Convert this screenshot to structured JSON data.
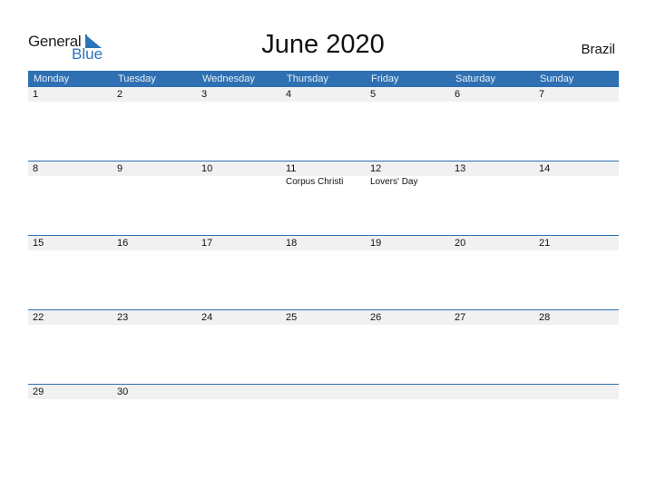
{
  "logo": {
    "word1": "General",
    "word2": "Blue"
  },
  "title": "June 2020",
  "country": "Brazil",
  "colors": {
    "header": "#2e70b1",
    "row_bg": "#f1f1f1"
  },
  "weekdays": [
    "Monday",
    "Tuesday",
    "Wednesday",
    "Thursday",
    "Friday",
    "Saturday",
    "Sunday"
  ],
  "weeks": [
    {
      "days": [
        "1",
        "2",
        "3",
        "4",
        "5",
        "6",
        "7"
      ],
      "holidays": [
        "",
        "",
        "",
        "",
        "",
        "",
        ""
      ]
    },
    {
      "days": [
        "8",
        "9",
        "10",
        "11",
        "12",
        "13",
        "14"
      ],
      "holidays": [
        "",
        "",
        "",
        "Corpus Christi",
        "Lovers' Day",
        "",
        ""
      ]
    },
    {
      "days": [
        "15",
        "16",
        "17",
        "18",
        "19",
        "20",
        "21"
      ],
      "holidays": [
        "",
        "",
        "",
        "",
        "",
        "",
        ""
      ]
    },
    {
      "days": [
        "22",
        "23",
        "24",
        "25",
        "26",
        "27",
        "28"
      ],
      "holidays": [
        "",
        "",
        "",
        "",
        "",
        "",
        ""
      ]
    },
    {
      "days": [
        "29",
        "30",
        "",
        "",
        "",
        "",
        ""
      ],
      "holidays": [
        "",
        "",
        "",
        "",
        "",
        "",
        ""
      ]
    }
  ]
}
